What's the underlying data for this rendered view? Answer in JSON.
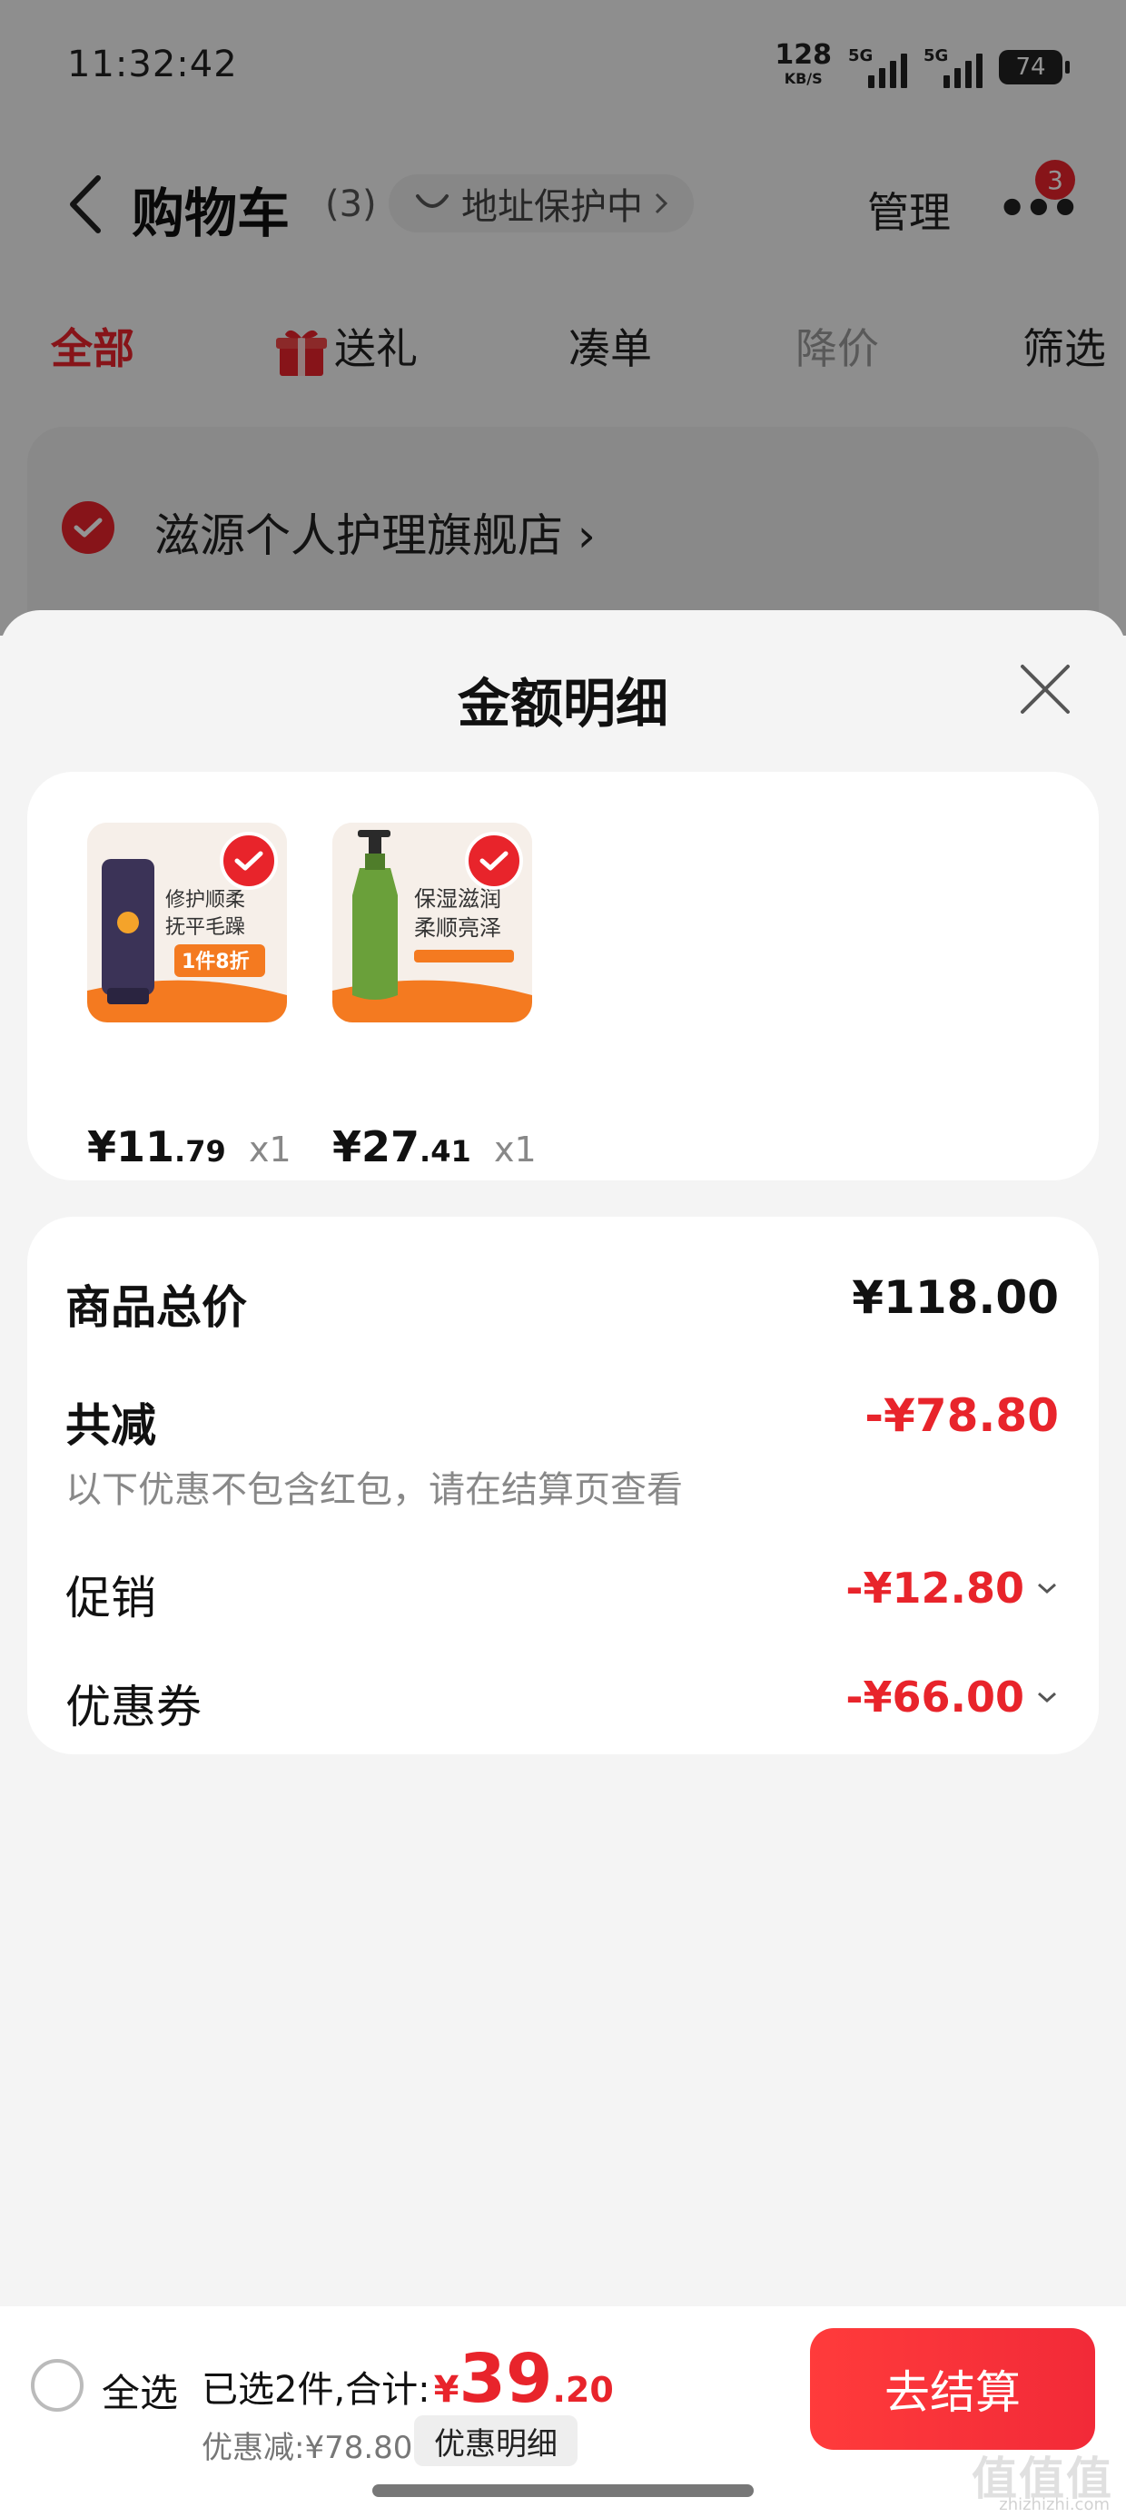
{
  "status_bar": {
    "time": "11:32:42",
    "net_speed": "128",
    "net_unit": "KB/S",
    "signal1": "5G",
    "signal2": "5G",
    "battery": "74"
  },
  "nav": {
    "title": "购物车",
    "count": "(3)",
    "address_protect": "地址保护中",
    "manage": "管理",
    "more": "•••",
    "badge": "3"
  },
  "tabs": [
    {
      "label": "全部"
    },
    {
      "label": "送礼"
    },
    {
      "label": "凑单"
    },
    {
      "label": "降价"
    },
    {
      "label": "筛选"
    }
  ],
  "store": {
    "name": "滋源个人护理旗舰店"
  },
  "sheet": {
    "title": "金额明细",
    "products": [
      {
        "price_int": "¥11",
        "price_dec": ".79",
        "qty": "x1",
        "img_line1": "修护顺柔",
        "img_line2": "抚平毛躁",
        "img_promo": "1件8折",
        "icon": "hair-mask-tube"
      },
      {
        "price_int": "¥27",
        "price_dec": ".41",
        "qty": "x1",
        "img_line1": "保湿滋润",
        "img_line2": "柔顺亮泽",
        "icon": "shampoo-pump-bottle"
      }
    ],
    "summary": {
      "total_label": "商品总价",
      "total_value": "¥118.00",
      "reduce_label": "共减",
      "reduce_value": "-¥78.80",
      "note": "以下优惠不包含红包，请在结算页查看",
      "promo_label": "促销",
      "promo_value": "-¥12.80",
      "coupon_label": "优惠券",
      "coupon_value": "-¥66.00"
    }
  },
  "bottom_bar": {
    "select_all": "全选",
    "selected_text": "已选2件,合计:",
    "total_yen": "¥",
    "total_int": "39",
    "total_dec": ".20",
    "discount_text": "优惠减:¥78.80",
    "detail_button": "优惠明细",
    "checkout": "去结算"
  },
  "watermark": {
    "text": "值值值",
    "sub": "zhizhizhi.com"
  },
  "colors": {
    "accent": "#e8242b",
    "background": "#f4f4f4",
    "card": "#ffffff"
  }
}
